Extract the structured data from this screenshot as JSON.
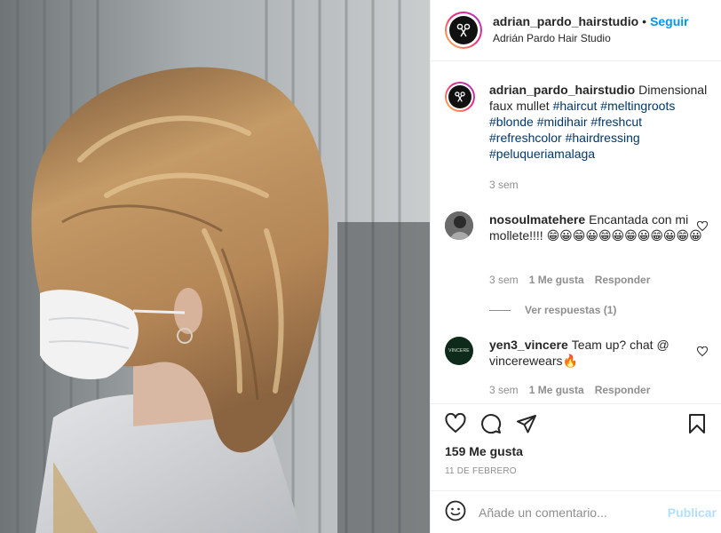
{
  "header": {
    "username": "adrian_pardo_hairstudio",
    "dot": "•",
    "follow_label": "Seguir",
    "subtitle": "Adrián Pardo Hair Studio"
  },
  "caption": {
    "username": "adrian_pardo_hairstudio",
    "text": "Dimensional faux mullet",
    "hashtags": [
      "#haircut",
      "#meltingroots",
      "#blonde",
      "#midihair",
      "#freshcut",
      "#refreshcolor",
      "#hairdressing",
      "#peluqueriamalaga"
    ],
    "time": "3 sem"
  },
  "comments": [
    {
      "username": "nosoulmatehere",
      "text": "Encantada con mi mollete!!!! 😁😀😁😀😁😀😁😀😁😀😁😀",
      "time": "3 sem",
      "likes": "1 Me gusta",
      "reply": "Responder",
      "view_replies": "Ver respuestas (1)"
    },
    {
      "username": "yen3_vincere",
      "text": "Team up? chat @ vincerewears🔥",
      "time": "3 sem",
      "likes": "1 Me gusta",
      "reply": "Responder",
      "avatar_text": "VINCERE"
    }
  ],
  "stats": {
    "likes": "159 Me gusta",
    "date": "11 DE FEBRERO"
  },
  "composer": {
    "placeholder": "Añade un comentario...",
    "publish_label": "Publicar"
  },
  "icons": [
    "scissors-logo-icon",
    "heart-icon",
    "comment-icon",
    "share-icon",
    "bookmark-icon",
    "emoji-icon"
  ],
  "colors": {
    "link": "#0095f6",
    "hashtag": "#00376b",
    "muted": "#8e8e8e",
    "publish_disabled": "#b2dffc"
  }
}
